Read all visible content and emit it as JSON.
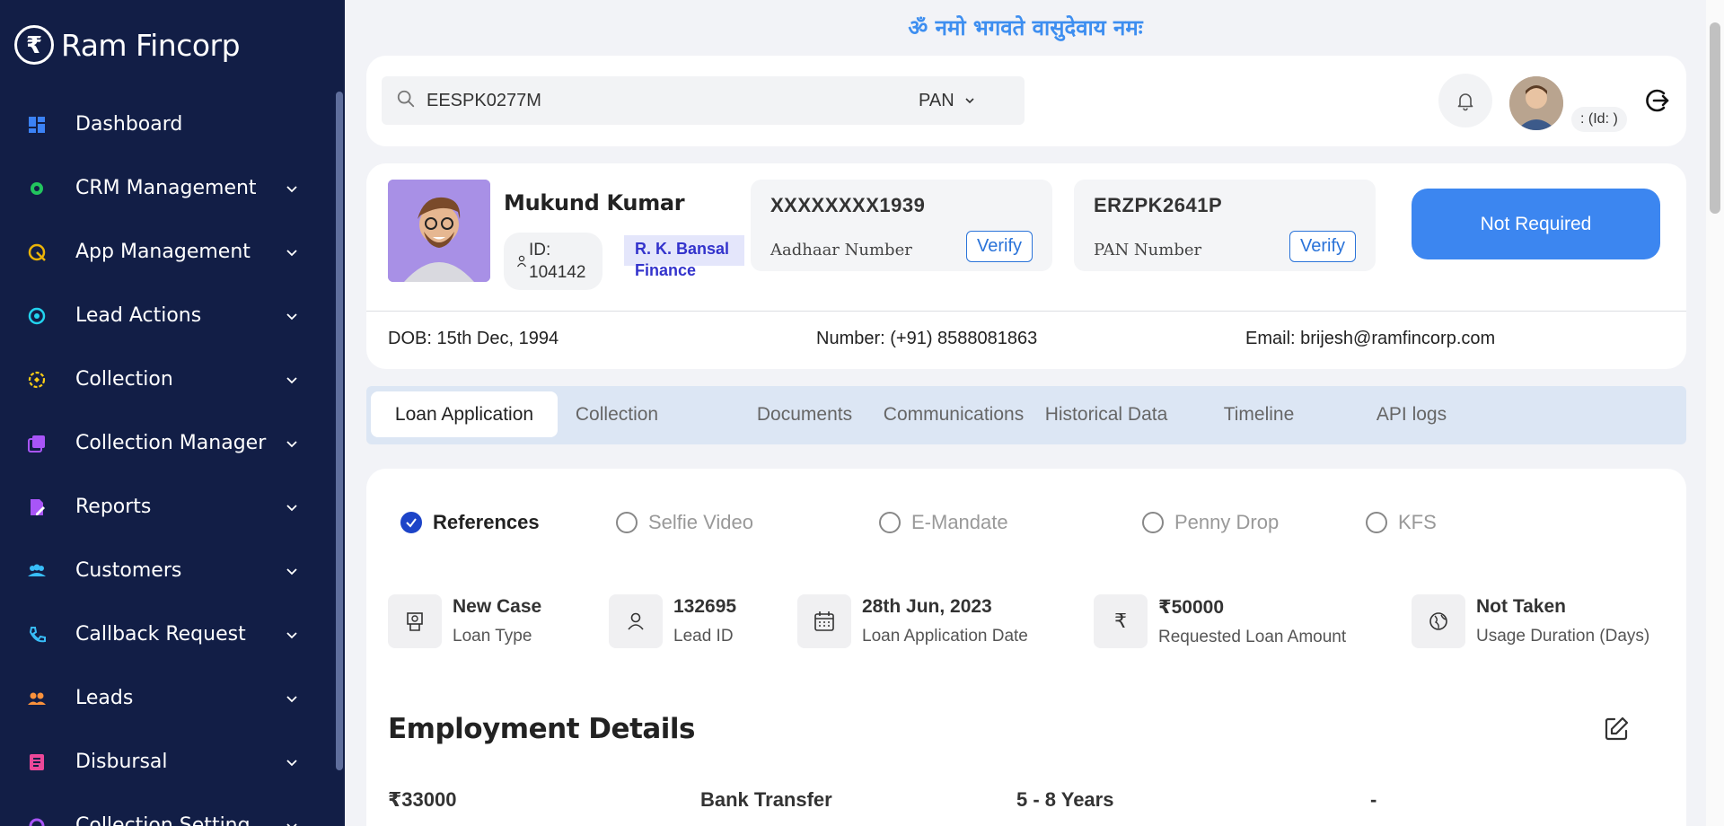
{
  "brand": {
    "name": "Ram Fincorp",
    "logo_glyph": "₹"
  },
  "sidebar": {
    "items": [
      {
        "label": "Dashboard",
        "icon": "dashboard-icon",
        "color": "#3b82f6",
        "has_chevron": false
      },
      {
        "label": "CRM Management",
        "icon": "gear-icon",
        "color": "#22c55e",
        "has_chevron": true
      },
      {
        "label": "App Management",
        "icon": "app-icon",
        "color": "#eab308",
        "has_chevron": true
      },
      {
        "label": "Lead Actions",
        "icon": "lead-icon",
        "color": "#22d3ee",
        "has_chevron": true
      },
      {
        "label": "Collection",
        "icon": "collection-icon",
        "color": "#facc15",
        "has_chevron": true
      },
      {
        "label": "Collection Manager",
        "icon": "stack-icon",
        "color": "#a855f7",
        "has_chevron": true
      },
      {
        "label": "Reports",
        "icon": "report-icon",
        "color": "#a855f7",
        "has_chevron": true
      },
      {
        "label": "Customers",
        "icon": "users-icon",
        "color": "#38bdf8",
        "has_chevron": true
      },
      {
        "label": "Callback Request",
        "icon": "phone-icon",
        "color": "#38bdf8",
        "has_chevron": true
      },
      {
        "label": "Leads",
        "icon": "people-icon",
        "color": "#fb923c",
        "has_chevron": true
      },
      {
        "label": "Disbursal",
        "icon": "ledger-icon",
        "color": "#ec4899",
        "has_chevron": true
      },
      {
        "label": "Collection Setting",
        "icon": "settings-icon",
        "color": "#a855f7",
        "has_chevron": true
      }
    ]
  },
  "header": {
    "mantra": "ॐ नमो भगवते वासुदेवाय नमः",
    "search_value": "EESPK0277M",
    "search_type": "PAN",
    "user_id_label": ": (Id: )"
  },
  "profile": {
    "name": "Mukund Kumar",
    "id_label": "ID:",
    "id_value": "104142",
    "company": "R. K. Bansal Finance",
    "aadhaar_number": "XXXXXXXX1939",
    "aadhaar_label": "Aadhaar Number",
    "pan_number": "ERZPK2641P",
    "pan_label": "PAN Number",
    "verify_label": "Verify",
    "status_button": "Not Required",
    "dob": "DOB: 15th Dec, 1994",
    "phone": "Number: (+91) 8588081863",
    "email": "Email: brijesh@ramfincorp.com"
  },
  "tabs": [
    "Loan Application",
    "Collection",
    "Documents",
    "Communications",
    "Historical Data",
    "Timeline",
    "API logs"
  ],
  "active_tab": "Loan Application",
  "steps": [
    {
      "label": "References",
      "done": true
    },
    {
      "label": "Selfie Video",
      "done": false
    },
    {
      "label": "E-Mandate",
      "done": false
    },
    {
      "label": "Penny Drop",
      "done": false
    },
    {
      "label": "KFS",
      "done": false
    }
  ],
  "stats": [
    {
      "value": "New Case",
      "label": "Loan Type",
      "icon": "money-icon"
    },
    {
      "value": "132695",
      "label": "Lead ID",
      "icon": "user-icon"
    },
    {
      "value": "28th Jun, 2023",
      "label": "Loan Application Date",
      "icon": "calendar-icon"
    },
    {
      "value": "₹50000",
      "label": "Requested Loan Amount",
      "icon": "rupee-icon"
    },
    {
      "value": "Not Taken",
      "label": "Usage Duration (Days)",
      "icon": "globe-icon"
    }
  ],
  "employment": {
    "title": "Employment Details",
    "values": [
      "₹33000",
      "Bank Transfer",
      "5 - 8 Years",
      "-"
    ]
  }
}
